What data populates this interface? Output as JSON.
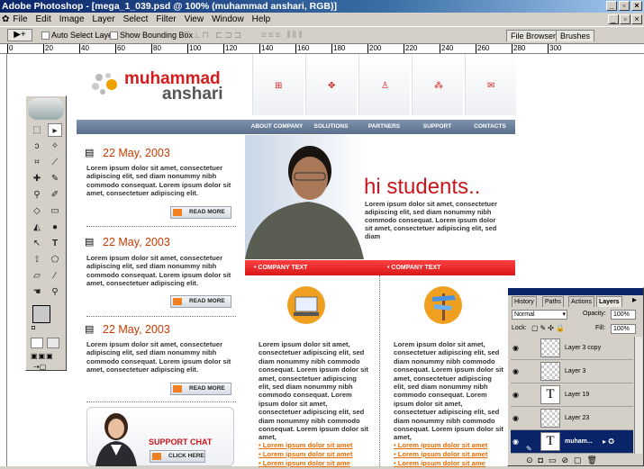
{
  "app": {
    "title": "Adobe Photoshop - [mega_1_039.psd @ 100% (muhammad      anshari, RGB)]"
  },
  "menu": [
    "File",
    "Edit",
    "Image",
    "Layer",
    "Select",
    "Filter",
    "View",
    "Window",
    "Help"
  ],
  "options": {
    "auto_select": "Auto Select Layer",
    "bounding_box": "Show Bounding Box"
  },
  "tabs": [
    "File Browser",
    "Brushes"
  ],
  "ruler": [
    "0",
    "20",
    "40",
    "60",
    "80",
    "100",
    "120",
    "140",
    "160",
    "180",
    "200",
    "220",
    "240",
    "260",
    "280",
    "300"
  ],
  "site": {
    "logo": {
      "line1": "muhammad",
      "line2": "anshari"
    },
    "nav": [
      "ABOUT COMPANY",
      "SOLUTIONS",
      "PARTNERS",
      "SUPPORT",
      "CONTACTS"
    ],
    "posts": [
      {
        "date": "22 May, 2003",
        "text": "Lorem ipsum dolor sit amet, consectetuer adipiscing elit, sed diam nonummy nibh commodo consequat. Lorem ipsum dolor sit amet, consectetuer adipiscing elit.",
        "button": "READ MORE"
      },
      {
        "date": "22 May, 2003",
        "text": "Lorem ipsum dolor sit amet, consectetuer adipiscing elit, sed diam nonummy nibh commodo consequat. Lorem ipsum dolor sit amet, consectetuer adipiscing elit.",
        "button": "READ MORE"
      },
      {
        "date": "22 May, 2003",
        "text": "Lorem ipsum dolor sit amet, consectetuer adipiscing elit, sed diam nonummy nibh commodo consequat. Lorem ipsum dolor sit amet, consectetuer adipiscing elit.",
        "button": "READ MORE"
      }
    ],
    "hero": {
      "heading": "hi students..",
      "text": "Lorem ipsum dolor sit amet, consectetuer adipiscing elit, sed diam nonummy nibh commodo consequat. Lorem ipsum dolor sit amet, consectetuer adipiscing elit, sed diam"
    },
    "company_bar": [
      "• COMPANY TEXT",
      "• COMPANY TEXT"
    ],
    "columns": [
      {
        "text": "Lorem ipsum dolor sit amet, consectetuer adipiscing elit, sed diam nonummy nibh commodo consequat. Lorem ipsum dolor sit amet, consectetuer adipiscing elit, sed diam nonummy nibh commodo consequat. Lorem ipsum dolor sit amet, consectetuer adipiscing elit, sed diam nonummy nibh commodo consequat. Lorem ipsum dolor sit amet,",
        "links": [
          "Lorem ipsum dolor sit amet",
          "Lorem ipsum dolor sit amet",
          "Lorem ipsum dolor sit ame"
        ]
      },
      {
        "text": "Lorem ipsum dolor sit amet, consectetuer adipiscing elit, sed diam nonummy nibh commodo consequat. Lorem ipsum dolor sit amet, consectetuer adipiscing elit, sed diam nonummy nibh commodo consequat. Lorem ipsum dolor sit amet, consectetuer adipiscing elit, sed diam nonummy nibh commodo consequat. Lorem ipsum dolor sit amet,",
        "links": [
          "Lorem ipsum dolor sit amet",
          "Lorem ipsum dolor sit amet",
          "Lorem ipsum dolor sit ame"
        ]
      }
    ],
    "support": {
      "title": "SUPPORT CHAT",
      "button": "CLICK HERE"
    }
  },
  "layers_panel": {
    "tabs": [
      "History",
      "Paths",
      "Actions",
      "Layers"
    ],
    "blend": "Normal",
    "opacity_label": "Opacity:",
    "opacity": "100%",
    "lock_label": "Lock:",
    "fill_label": "Fill:",
    "fill": "100%",
    "layers": [
      "Layer 3 copy",
      "Layer 3",
      "Layer 19",
      "Layer 23",
      "muham..."
    ]
  }
}
